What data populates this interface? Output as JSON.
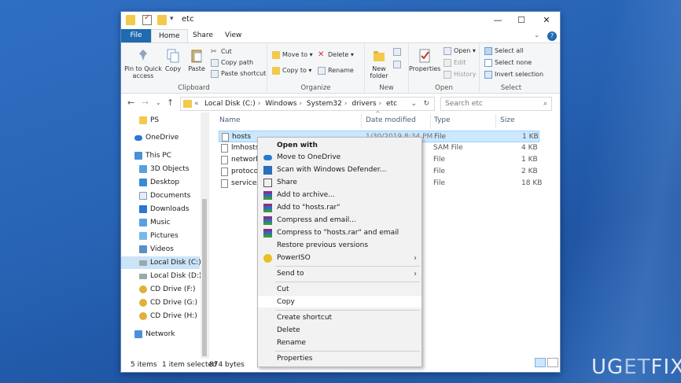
{
  "window": {
    "title": "etc",
    "controls": {
      "minimize": "—",
      "maximize": "☐",
      "close": "✕"
    }
  },
  "ribbon_tabs": [
    "File",
    "Home",
    "Share",
    "View"
  ],
  "ribbon": {
    "clipboard": {
      "label": "Clipboard",
      "pin": "Pin to Quick access",
      "copy": "Copy",
      "paste": "Paste",
      "cut": "Cut",
      "copy_path": "Copy path",
      "paste_shortcut": "Paste shortcut"
    },
    "organize": {
      "label": "Organize",
      "move_to": "Move to",
      "copy_to": "Copy to",
      "delete": "Delete",
      "rename": "Rename"
    },
    "new": {
      "label": "New",
      "new_folder": "New folder"
    },
    "open": {
      "label": "Open",
      "properties": "Properties",
      "open": "Open",
      "edit": "Edit",
      "history": "History"
    },
    "select": {
      "label": "Select",
      "select_all": "Select all",
      "select_none": "Select none",
      "invert": "Invert selection"
    }
  },
  "address": {
    "prefix": "«",
    "crumbs": [
      "Local Disk (C:)",
      "Windows",
      "System32",
      "drivers",
      "etc"
    ],
    "search_placeholder": "Search etc"
  },
  "nav_pane": [
    {
      "label": "PS",
      "icon": "folder-icon"
    },
    {
      "label": "OneDrive",
      "icon": "cloud-icon"
    },
    {
      "label": "This PC",
      "icon": "computer-icon"
    },
    {
      "label": "3D Objects",
      "icon": "cube-icon"
    },
    {
      "label": "Desktop",
      "icon": "desktop-icon"
    },
    {
      "label": "Documents",
      "icon": "documents-icon"
    },
    {
      "label": "Downloads",
      "icon": "download-icon"
    },
    {
      "label": "Music",
      "icon": "music-icon"
    },
    {
      "label": "Pictures",
      "icon": "pictures-icon"
    },
    {
      "label": "Videos",
      "icon": "videos-icon"
    },
    {
      "label": "Local Disk (C:)",
      "icon": "drive-icon",
      "selected": true
    },
    {
      "label": "Local Disk (D:)",
      "icon": "drive-icon"
    },
    {
      "label": "CD Drive (F:)",
      "icon": "cd-icon"
    },
    {
      "label": "CD Drive (G:)",
      "icon": "cd-icon"
    },
    {
      "label": "CD Drive (H:)",
      "icon": "cd-icon"
    },
    {
      "label": "Network",
      "icon": "network-icon"
    }
  ],
  "columns": {
    "name": "Name",
    "date": "Date modified",
    "type": "Type",
    "size": "Size"
  },
  "files": [
    {
      "name": "hosts",
      "date": "1/30/2019 8:34 PM",
      "type": "File",
      "size": "1 KB",
      "selected": true
    },
    {
      "name": "lmhosts.s",
      "date": "",
      "type": "SAM File",
      "size": "4 KB"
    },
    {
      "name": "networks",
      "date": "",
      "type": "File",
      "size": "1 KB"
    },
    {
      "name": "protocol",
      "date": "",
      "type": "File",
      "size": "2 KB"
    },
    {
      "name": "services",
      "date": "",
      "type": "File",
      "size": "18 KB"
    }
  ],
  "context_menu": [
    {
      "label": "Open with",
      "bold": true
    },
    {
      "label": "Move to OneDrive",
      "icon": "onedrive-icon"
    },
    {
      "label": "Scan with Windows Defender...",
      "icon": "defender-icon"
    },
    {
      "label": "Share",
      "icon": "share-icon"
    },
    {
      "label": "Add to archive...",
      "icon": "winrar-icon"
    },
    {
      "label": "Add to \"hosts.rar\"",
      "icon": "winrar-icon"
    },
    {
      "label": "Compress and email...",
      "icon": "winrar-icon"
    },
    {
      "label": "Compress to \"hosts.rar\" and email",
      "icon": "winrar-icon"
    },
    {
      "label": "Restore previous versions"
    },
    {
      "label": "PowerISO",
      "icon": "poweriso-icon",
      "submenu": true
    },
    {
      "label": "Send to",
      "submenu": true
    },
    {
      "label": "Cut"
    },
    {
      "label": "Copy",
      "hover": true
    },
    {
      "label": "Create shortcut"
    },
    {
      "label": "Delete"
    },
    {
      "label": "Rename"
    },
    {
      "label": "Properties"
    }
  ],
  "status": {
    "items": "5 items",
    "selected": "1 item selected",
    "size": "874 bytes"
  },
  "watermark": {
    "left": "U",
    "mid": "G",
    "accent": "ET",
    "right": "FIX"
  },
  "colors": {
    "accent": "#1f6ab0",
    "selection": "#cce8ff",
    "desktop": "#2864b6"
  }
}
